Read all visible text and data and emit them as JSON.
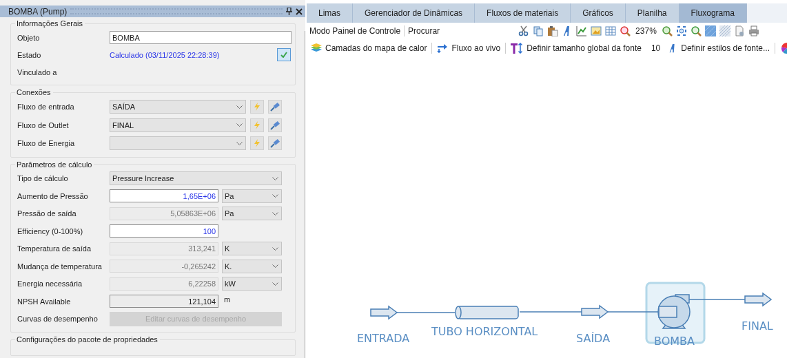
{
  "panel": {
    "title": "BOMBA (Pump)",
    "general": {
      "title": "Informações Gerais",
      "object_label": "Objeto",
      "object_value": "BOMBA",
      "status_label": "Estado",
      "status_value": "Calculado (03/11/2025 22:28:39)",
      "linked_label": "Vinculado a"
    },
    "connections": {
      "title": "Conexões",
      "rows": [
        {
          "label": "Fluxo de entrada",
          "value": "SAÍDA"
        },
        {
          "label": "Fluxo de Outlet",
          "value": "FINAL"
        },
        {
          "label": "Fluxo de Energia"
        }
      ]
    },
    "calculation": {
      "title": "Parâmetros de cálculo",
      "rows": [
        {
          "kind": "select",
          "label": "Tipo de cálculo",
          "value": "Pressure Increase"
        },
        {
          "kind": "input",
          "label": "Aumento de Pressão",
          "value": "1,65E+06",
          "unit": "Pa"
        },
        {
          "kind": "readonly",
          "label": "Pressão de saída",
          "value": "5,05863E+06",
          "unit": "Pa"
        },
        {
          "kind": "input",
          "label": "Efficiency (0-100%)",
          "value": "100"
        },
        {
          "kind": "readonly",
          "label": "Temperatura de saída",
          "value": "313,241",
          "unit": "K"
        },
        {
          "kind": "readonly",
          "label": "Mudança de temperatura",
          "value": "-0,265242",
          "unit": "K."
        },
        {
          "kind": "readonly",
          "label": "Energia necessária",
          "value": "6,22258",
          "unit": "kW"
        },
        {
          "kind": "output",
          "label": "NPSH Available",
          "value": "121,104",
          "unit": "m"
        },
        {
          "kind": "button",
          "label": "Curvas de desempenho",
          "value": "Editar curvas de desempenho",
          "disabled": true
        }
      ]
    },
    "property_package": {
      "title": "Configurações do pacote de propriedades"
    }
  },
  "tabs": [
    {
      "label": "Limas",
      "selected": false
    },
    {
      "label": "Gerenciador de Dinâmicas",
      "selected": false
    },
    {
      "label": "Fluxos de materiais",
      "selected": false
    },
    {
      "label": "Gráficos",
      "selected": false
    },
    {
      "label": "Planilha",
      "selected": false
    },
    {
      "label": "Fluxograma",
      "selected": true
    }
  ],
  "toolbar": {
    "mode_label": "Modo Painel de Controle",
    "search_label": "Procurar",
    "zoom": "237%",
    "heatmap_button": "Camadas do mapa de calor",
    "live_flow_button": "Fluxo ao vivo",
    "font_size_button": "Definir tamanho global da fonte",
    "font_size": "10",
    "font_styles_button": "Definir estilos de fonte..."
  },
  "flowsheet": {
    "blocks": [
      {
        "kind": "stream",
        "label": "ENTRADA",
        "selected": false
      },
      {
        "kind": "pipe",
        "label": "TUBO HORIZONTAL",
        "selected": false
      },
      {
        "kind": "stream",
        "label": "SAÍDA",
        "selected": false
      },
      {
        "kind": "pump",
        "label": "BOMBA",
        "selected": true
      },
      {
        "kind": "stream",
        "label": "FINAL",
        "selected": false
      }
    ]
  }
}
